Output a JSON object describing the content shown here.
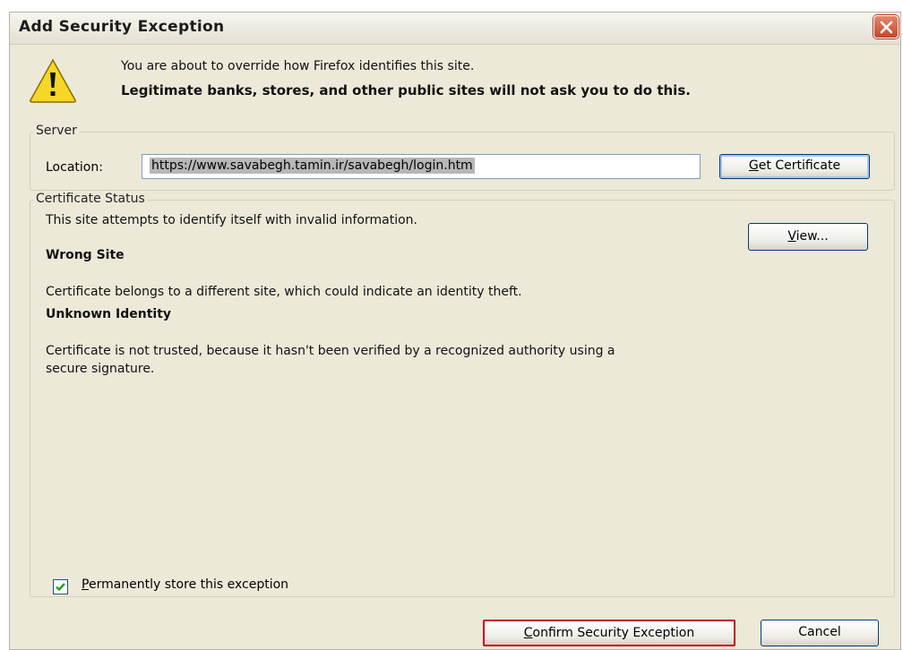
{
  "dialog": {
    "title": "Add Security Exception",
    "intro_line1": "You are about to override how Firefox identifies this site.",
    "intro_line2": "Legitimate banks, stores, and other public sites will not ask you to do this."
  },
  "server": {
    "legend": "Server",
    "location_label": "Location:",
    "location_value": "https://www.savabegh.tamin.ir/savabegh/login.htm",
    "get_certificate_prefix": "G",
    "get_certificate_rest": "et Certificate"
  },
  "status": {
    "legend": "Certificate Status",
    "summary": "This site attempts to identify itself with invalid information.",
    "view_prefix": "V",
    "view_rest": "iew...",
    "wrong_site_title": "Wrong Site",
    "wrong_site_text": "Certificate belongs to a different site, which could indicate an identity theft.",
    "unknown_identity_title": "Unknown Identity",
    "unknown_identity_text_line1": "Certificate is not trusted, because it hasn't been verified by a recognized authority using a",
    "unknown_identity_text_line2": "secure signature."
  },
  "options": {
    "permanent_prefix": "P",
    "permanent_rest": "ermanently store this exception",
    "permanent_checked": true
  },
  "footer": {
    "confirm_prefix": "C",
    "confirm_rest": "onfirm Security Exception",
    "cancel_label": "Cancel"
  },
  "icons": {
    "warning": "warning-triangle-icon",
    "close": "close-icon",
    "check": "checkmark-icon"
  },
  "colors": {
    "window_bg": "#ece9d8",
    "close_bg": "#c4452a",
    "confirm_border": "#c80024",
    "warning_yellow": "#f6d626"
  }
}
